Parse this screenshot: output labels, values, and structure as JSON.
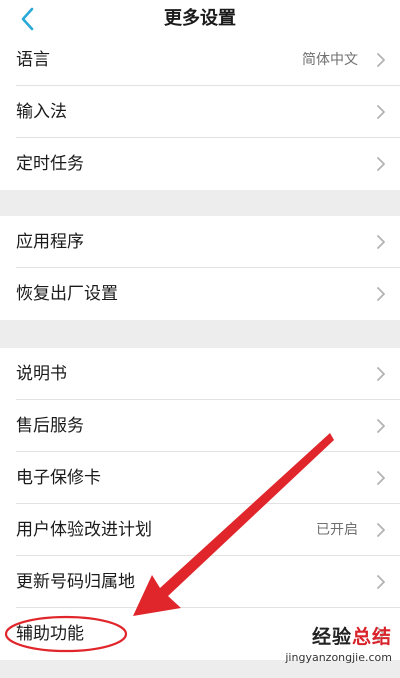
{
  "header": {
    "title": "更多设置"
  },
  "groups": [
    {
      "items": [
        {
          "label": "语言",
          "value": "简体中文"
        },
        {
          "label": "输入法",
          "value": ""
        },
        {
          "label": "定时任务",
          "value": ""
        }
      ]
    },
    {
      "items": [
        {
          "label": "应用程序",
          "value": ""
        },
        {
          "label": "恢复出厂设置",
          "value": ""
        }
      ]
    },
    {
      "items": [
        {
          "label": "说明书",
          "value": ""
        },
        {
          "label": "售后服务",
          "value": ""
        },
        {
          "label": "电子保修卡",
          "value": ""
        },
        {
          "label": "用户体验改进计划",
          "value": "已开启"
        },
        {
          "label": "更新号码归属地",
          "value": ""
        },
        {
          "label": "辅助功能",
          "value": ""
        }
      ]
    }
  ],
  "watermark": {
    "line1_a": "经验",
    "line1_b": "总结",
    "line2": "jingyanzongjie.com"
  },
  "colors": {
    "accent": "#2aa9d8",
    "annotation": "#e0262b"
  },
  "icons": {
    "back": "chevron-left-icon",
    "row": "chevron-right-icon"
  }
}
